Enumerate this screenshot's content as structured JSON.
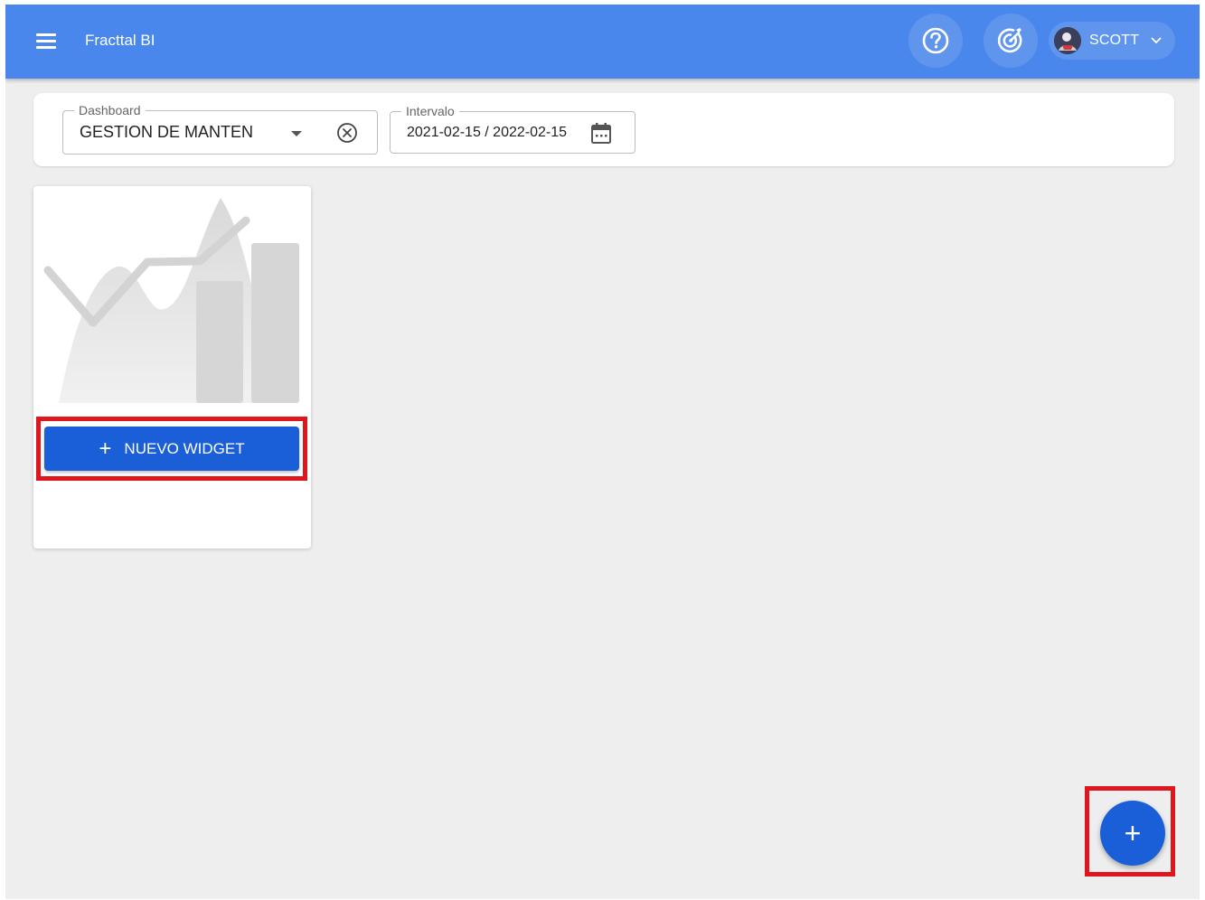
{
  "app": {
    "title": "Fracttal BI"
  },
  "header": {
    "menu_icon": "hamburger-menu-icon",
    "help_icon": "help-circle-icon",
    "target_icon": "target-icon",
    "user": {
      "name": "SCOTT",
      "caret_icon": "chevron-down-icon"
    }
  },
  "filters": {
    "dashboard": {
      "label": "Dashboard",
      "value": "GESTION DE MANTEN"
    },
    "interval": {
      "label": "Intervalo",
      "value": "2021-02-15 / 2022-02-15"
    }
  },
  "widget_card": {
    "placeholder_icon": "chart-placeholder-icon",
    "button_icon": "+",
    "button_label": "NUEVO WIDGET"
  },
  "fab": {
    "label": "+"
  },
  "colors": {
    "header": "#4a87ec",
    "primary": "#1a5fd8",
    "background": "#eeeeee",
    "highlight": "#e0161e"
  }
}
